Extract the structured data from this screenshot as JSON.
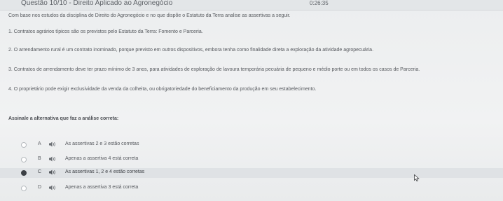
{
  "header": {
    "title": "Questão 10/10 - Direito Aplicado ao Agronegócio",
    "timer": "0:26:35"
  },
  "question": {
    "statement": "Com base nos estudos da disciplina de Direito do Agronegócio e no que dispõe o Estatuto da Terra analise as assertivas a seguir.",
    "items": [
      "1. Contratos agrários típicos são os previstos pelo Estatuto da Terra: Fomento e Parceria.",
      "2. O arrendamento rural é um contrato inominado, porque previsto em outros dispositivos, embora tenha como finalidade direta a exploração da atividade agropecuária.",
      "3. Contratos de arrendamento deve ter prazo mínimo de 3 anos, para atividades de exploração de lavoura temporária pecuária de pequeno e médio porte ou em todos os casos de Parceria.",
      "4. O proprietário pode exigir exclusividade da venda da colheita, ou obrigatoriedade do beneficiamento da produção em seu estabelecimento."
    ],
    "prompt": "Assinale a alternativa que faz a análise correta:"
  },
  "options": [
    {
      "letter": "A",
      "text": "As assertivas 2 e 3 estão corretas",
      "selected": false
    },
    {
      "letter": "B",
      "text": "Apenas a assertiva 4 está correta",
      "selected": false
    },
    {
      "letter": "C",
      "text": "As assertivas 1, 2 e 4 estão corretas",
      "selected": true
    },
    {
      "letter": "D",
      "text": "Apenas a assertiva 3 está correta",
      "selected": false
    }
  ],
  "icons": {
    "audio": "speaker-icon",
    "cursor": "mouse-pointer-icon"
  }
}
